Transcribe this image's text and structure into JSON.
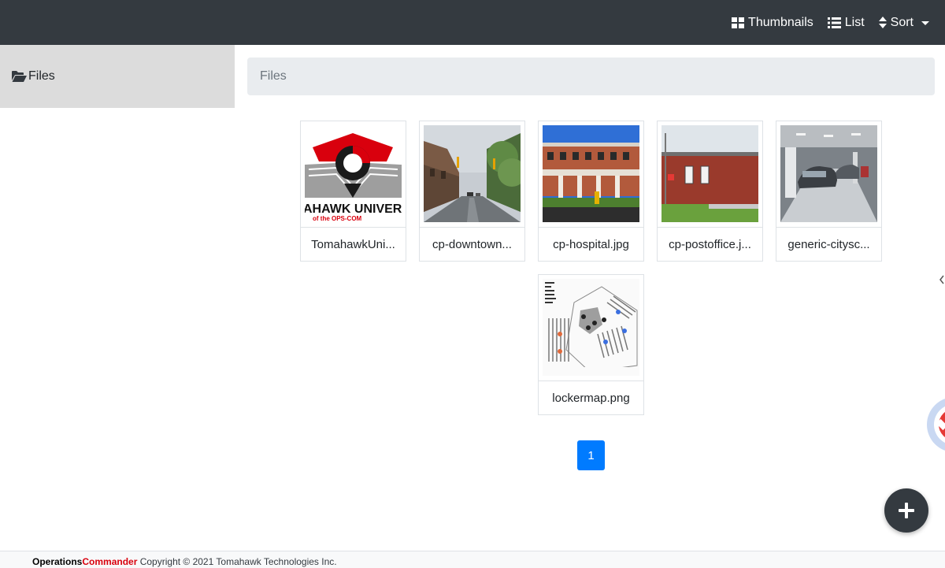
{
  "toolbar": {
    "thumbnails_label": "Thumbnails",
    "list_label": "List",
    "sort_label": "Sort"
  },
  "sidebar": {
    "items": [
      {
        "label": "Files",
        "icon": "folder-open-icon"
      }
    ]
  },
  "breadcrumb": {
    "label": "Files"
  },
  "files": [
    {
      "name": "TomahawkUni...",
      "logo_text_main": "AHAWK UNIVER",
      "logo_text_sub": "of the OPS-COM"
    },
    {
      "name": "cp-downtown..."
    },
    {
      "name": "cp-hospital.jpg"
    },
    {
      "name": "cp-postoffice.j..."
    },
    {
      "name": "generic-citysc..."
    },
    {
      "name": "lockermap.png"
    }
  ],
  "pagination": {
    "current": "1"
  },
  "footer": {
    "brand_part1": "Operations",
    "brand_part2": "Commander",
    "copyright": "Copyright © 2021 Tomahawk Technologies Inc."
  },
  "colors": {
    "topbar": "#343a40",
    "accent": "#007bff",
    "brand_red": "#d9000d"
  }
}
